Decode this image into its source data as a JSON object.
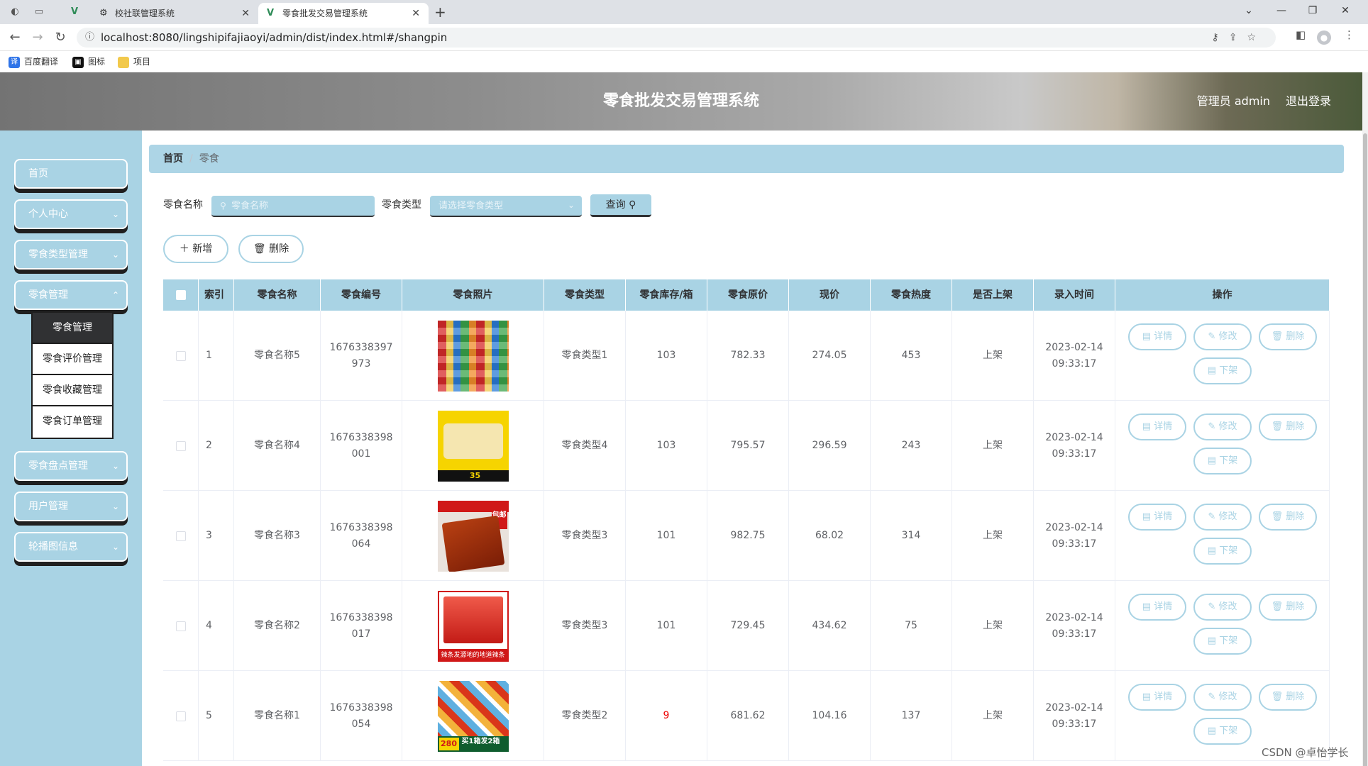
{
  "browser": {
    "tabs": [
      {
        "title": "校社联管理系统"
      },
      {
        "title": "零食批发交易管理系统"
      }
    ],
    "url": "localhost:8080/lingshipifajiaoyi/admin/dist/index.html#/shangpin",
    "bookmarks": [
      "百度翻译",
      "图标",
      "项目"
    ]
  },
  "header": {
    "title": "零食批发交易管理系统",
    "user": "管理员 admin",
    "logout": "退出登录"
  },
  "sidebar": {
    "items": [
      {
        "label": "首页"
      },
      {
        "label": "个人中心"
      },
      {
        "label": "零食类型管理"
      },
      {
        "label": "零食管理"
      },
      {
        "label": "零食盘点管理"
      },
      {
        "label": "用户管理"
      },
      {
        "label": "轮播图信息"
      }
    ],
    "submenu": [
      "零食管理",
      "零食评价管理",
      "零食收藏管理",
      "零食订单管理"
    ]
  },
  "breadcrumb": {
    "home": "首页",
    "current": "零食"
  },
  "search": {
    "name_label": "零食名称",
    "name_placeholder": "零食名称",
    "type_label": "零食类型",
    "type_placeholder": "请选择零食类型",
    "query": "查询"
  },
  "actions": {
    "add": "新增",
    "delete": "删除"
  },
  "table": {
    "headers": [
      "索引",
      "零食名称",
      "零食编号",
      "零食照片",
      "零食类型",
      "零食库存/箱",
      "零食原价",
      "现价",
      "零食热度",
      "是否上架",
      "录入时间",
      "操作"
    ],
    "op_labels": {
      "detail": "详情",
      "edit": "修改",
      "delete": "删除",
      "offshelf": "下架"
    },
    "rows": [
      {
        "index": "1",
        "name": "零食名称5",
        "code": "1676338397973",
        "type": "零食类型1",
        "stock": "103",
        "orig": "782.33",
        "price": "274.05",
        "heat": "453",
        "onshelf": "上架",
        "time": "2023-02-14 09:33:17",
        "stock_low": false,
        "img": "assorted-snacks"
      },
      {
        "index": "2",
        "name": "零食名称4",
        "code": "1676338398001",
        "type": "零食类型4",
        "stock": "103",
        "orig": "795.57",
        "price": "296.59",
        "heat": "243",
        "onshelf": "上架",
        "time": "2023-02-14 09:33:17",
        "stock_low": false,
        "img": "chips-pack"
      },
      {
        "index": "3",
        "name": "零食名称3",
        "code": "1676338398064",
        "type": "零食类型3",
        "stock": "101",
        "orig": "982.75",
        "price": "68.02",
        "heat": "314",
        "onshelf": "上架",
        "time": "2023-02-14 09:33:17",
        "stock_low": false,
        "img": "spicy-strips"
      },
      {
        "index": "4",
        "name": "零食名称2",
        "code": "1676338398017",
        "type": "零食类型3",
        "stock": "101",
        "orig": "729.45",
        "price": "434.62",
        "heat": "75",
        "onshelf": "上架",
        "time": "2023-02-14 09:33:17",
        "stock_low": false,
        "img": "latiao-box"
      },
      {
        "index": "5",
        "name": "零食名称1",
        "code": "1676338398054",
        "type": "零食类型2",
        "stock": "9",
        "orig": "681.62",
        "price": "104.16",
        "heat": "137",
        "onshelf": "上架",
        "time": "2023-02-14 09:33:17",
        "stock_low": true,
        "img": "snack-gift-box"
      }
    ]
  },
  "image_text": {
    "row2_badge": "35",
    "row3_banner": "包邮",
    "row4_caption": "辣条发源地的地道辣条",
    "row5_price": "280",
    "row5_promo": "买1箱发2箱"
  },
  "watermark": "CSDN @卓怡学长",
  "colors": {
    "accent": "#a9d3e4",
    "dark": "#303133",
    "stock_low": "#ee0000"
  }
}
